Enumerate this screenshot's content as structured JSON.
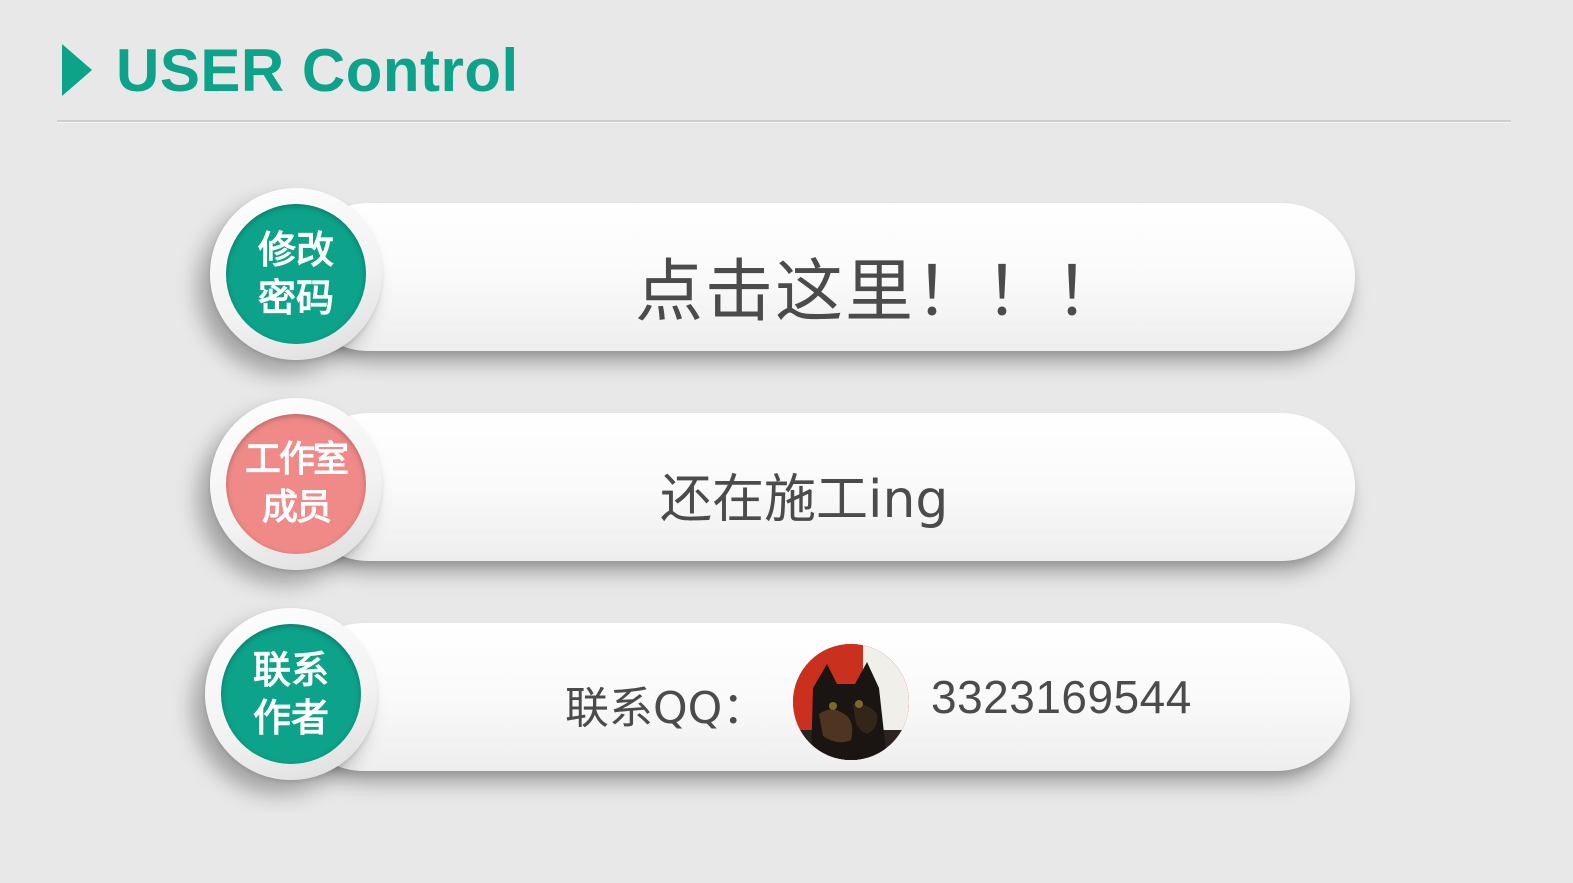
{
  "header": {
    "title": "USER Control",
    "accent_color": "#0ca38a"
  },
  "rows": [
    {
      "badge": {
        "line1": "修改",
        "line2": "密码",
        "color": "#0ca38a"
      },
      "text": "点击这里！！！"
    },
    {
      "badge": {
        "line1": "工作室",
        "line2": "成员",
        "color": "#f08a88"
      },
      "text": "还在施工ing"
    },
    {
      "badge": {
        "line1": "联系",
        "line2": "作者",
        "color": "#0ca38a"
      },
      "contact_label": "联系QQ：",
      "avatar_icon": "cat-avatar-icon",
      "qq_number": "3323169544"
    }
  ]
}
